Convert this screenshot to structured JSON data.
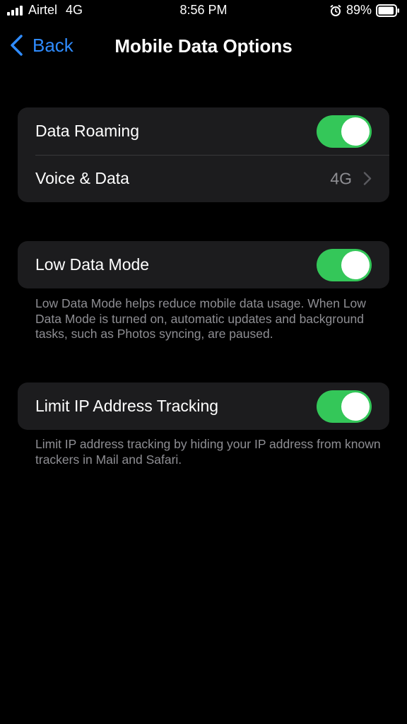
{
  "status_bar": {
    "carrier": "Airtel",
    "network": "4G",
    "time": "8:56 PM",
    "battery": "89%",
    "icons": [
      "signal-icon",
      "alarm-icon",
      "battery-icon"
    ]
  },
  "nav": {
    "back_label": "Back",
    "title": "Mobile Data Options"
  },
  "group1": {
    "data_roaming": {
      "label": "Data Roaming",
      "on": true
    },
    "voice_data": {
      "label": "Voice & Data",
      "value": "4G"
    }
  },
  "group2": {
    "low_data_mode": {
      "label": "Low Data Mode",
      "on": true
    },
    "footnote": "Low Data Mode helps reduce mobile data usage. When Low Data Mode is turned on, automatic updates and background tasks, such as Photos syncing, are paused."
  },
  "group3": {
    "limit_ip": {
      "label": "Limit IP Address Tracking",
      "on": true
    },
    "footnote": "Limit IP address tracking by hiding your IP address from known trackers in Mail and Safari."
  },
  "colors": {
    "background": "#000000",
    "cell": "#1c1c1e",
    "accent": "#2f8cff",
    "toggle_on": "#34c759",
    "secondary_text": "#8e8e93"
  }
}
